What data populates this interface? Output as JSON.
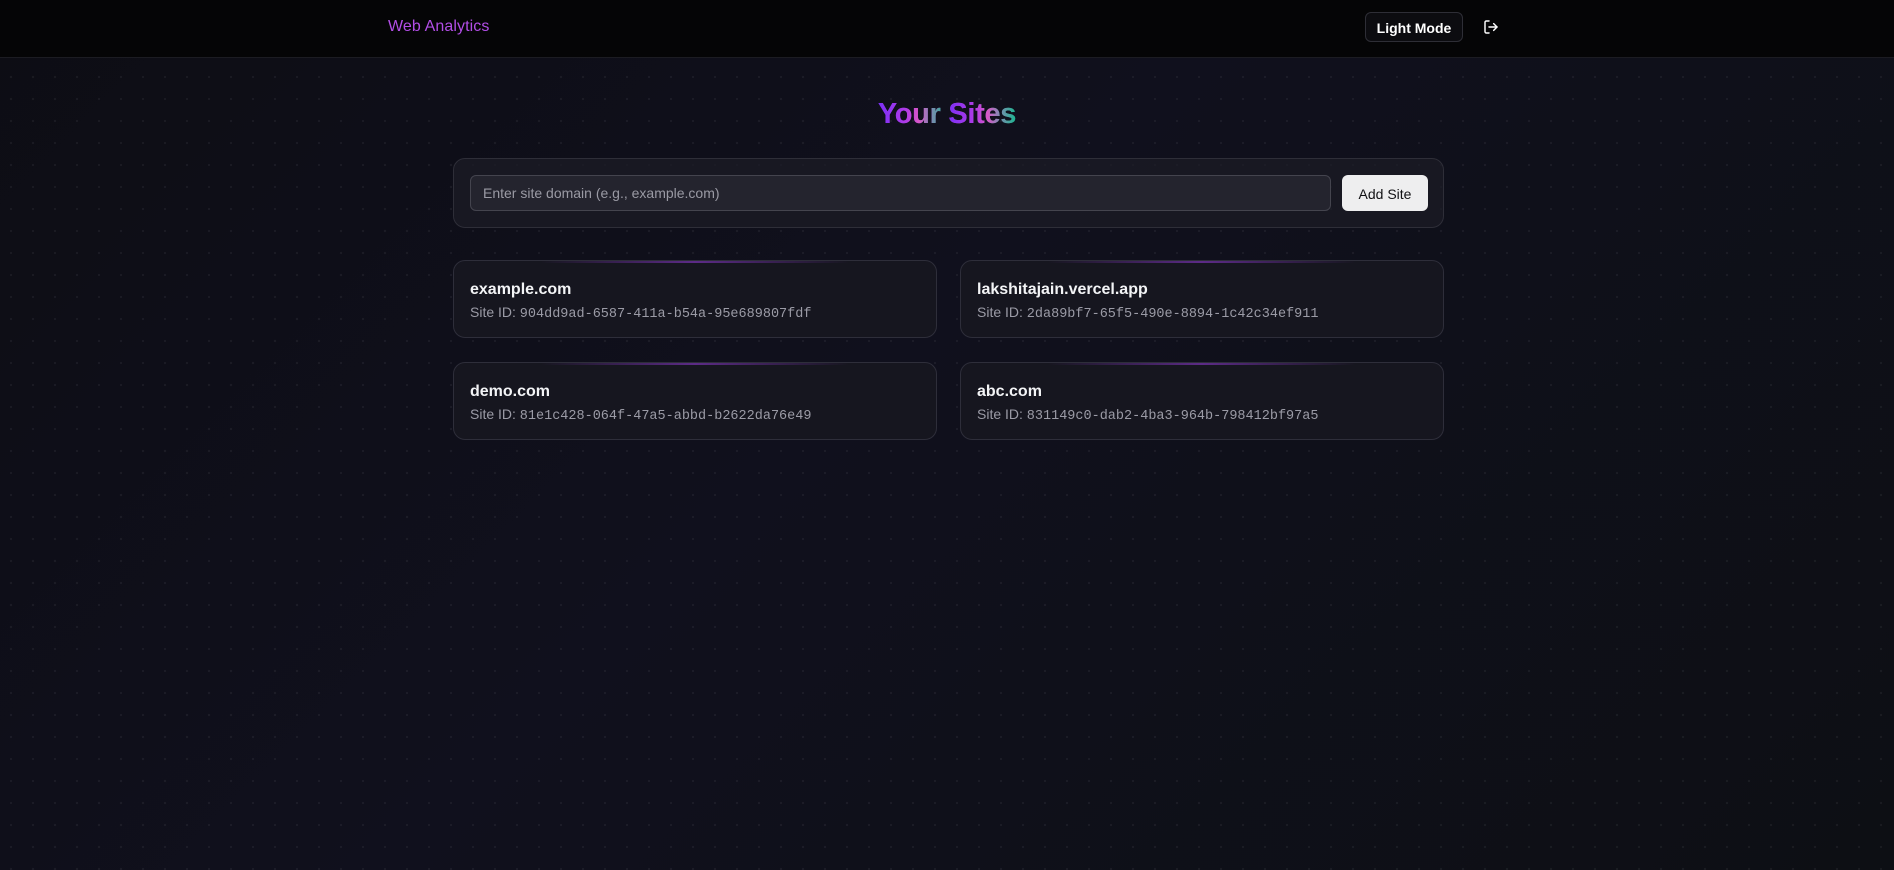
{
  "header": {
    "brand": "Web Analytics",
    "mode_toggle_label": "Light Mode",
    "logout_icon": "logout-icon"
  },
  "main": {
    "title_parts": [
      "Your ",
      "Sites"
    ],
    "title_colors": [
      "#7b2ff7",
      "#b03be6",
      "#d957c8",
      "#19b890"
    ],
    "add_form": {
      "placeholder": "Enter site domain (e.g., example.com)",
      "value": "",
      "button_label": "Add Site"
    },
    "site_id_label": "Site ID:",
    "sites": [
      {
        "domain": "example.com",
        "site_id": "904dd9ad-6587-411a-b54a-95e689807fdf"
      },
      {
        "domain": "lakshitajain.vercel.app",
        "site_id": "2da89bf7-65f5-490e-8894-1c42c34ef911"
      },
      {
        "domain": "demo.com",
        "site_id": "81e1c428-064f-47a5-abbd-b2622da76e49"
      },
      {
        "domain": "abc.com",
        "site_id": "831149c0-dab2-4ba3-964b-798412bf97a5"
      }
    ]
  },
  "colors": {
    "brand": "#b24ee6",
    "background": "#0e0e17",
    "topbar": "#050506"
  }
}
